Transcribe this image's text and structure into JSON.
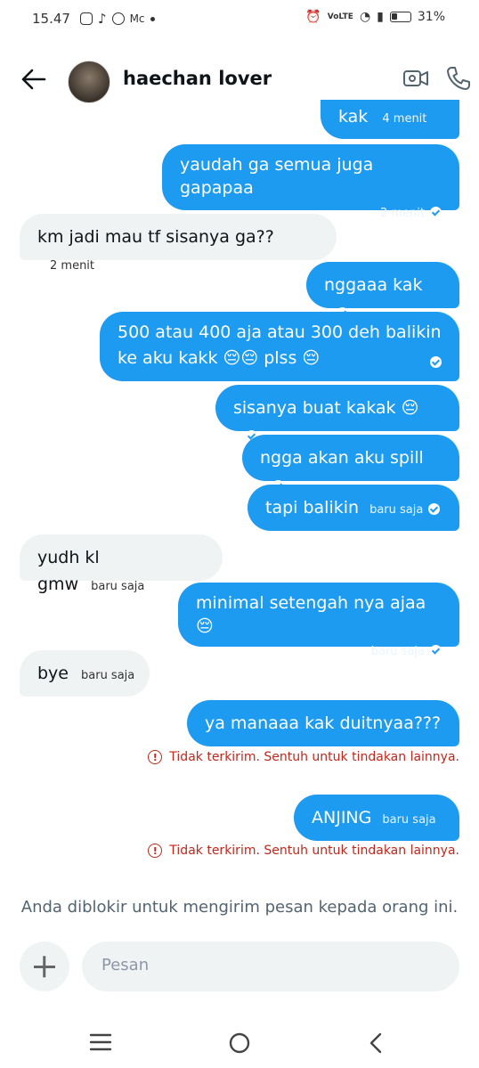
{
  "status_bar": {
    "time": "15.47",
    "notif": "Mc",
    "battery": "31%"
  },
  "header": {
    "title": "haechan lover"
  },
  "messages": [
    {
      "dir": "out",
      "text": "kak",
      "time": "4 menit"
    },
    {
      "dir": "out",
      "text": "yaudah ga semua juga gapapaa",
      "time": "2 menit"
    },
    {
      "dir": "in",
      "text": "km jadi mau tf sisanya ga??",
      "time": "2 menit"
    },
    {
      "dir": "out",
      "text": "nggaaa kak"
    },
    {
      "dir": "out",
      "text": "500 atau 400 aja atau 300 deh balikin",
      "text2": "ke aku kakk 😔😔 plss 😔"
    },
    {
      "dir": "out",
      "text": "sisanya buat kakak 😔"
    },
    {
      "dir": "out",
      "text": "ngga akan aku spill"
    },
    {
      "dir": "out",
      "text": "tapi balikin",
      "time": "baru saja"
    },
    {
      "dir": "in",
      "text": "yudh kl gmw",
      "time": "baru saja"
    },
    {
      "dir": "out",
      "text": "minimal setengah nya ajaa 😔",
      "time": "baru saja"
    },
    {
      "dir": "in",
      "text": "bye",
      "time": "baru saja"
    },
    {
      "dir": "out",
      "text": "ya manaaa kak duitnyaa???"
    },
    {
      "dir": "out",
      "text": "ANJING",
      "time": "baru saja"
    }
  ],
  "error_text": "Tidak terkirim. Sentuh untuk tindakan lainnya.",
  "blocked_notice": "Anda diblokir untuk mengirim pesan kepada orang ini.",
  "composer": {
    "placeholder": "Pesan"
  },
  "icons": [
    "back-arrow-icon",
    "video-call-icon",
    "phone-icon",
    "add-icon",
    "menu-icon",
    "home-icon",
    "back-nav-icon"
  ]
}
